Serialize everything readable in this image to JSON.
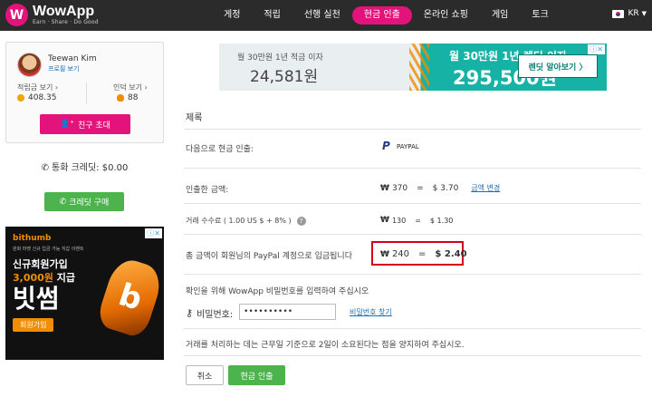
{
  "app": {
    "name": "WowApp",
    "tagline": "Earn · Share · Do Good",
    "logo_letter": "W",
    "brand_color": "#e4137c",
    "accent_green": "#4db34d"
  },
  "nav": {
    "items": [
      {
        "label": "게정"
      },
      {
        "label": "적립"
      },
      {
        "label": "선행 실천"
      },
      {
        "label": "현금 인출"
      },
      {
        "label": "온라인 쇼핑"
      },
      {
        "label": "게임"
      },
      {
        "label": "토크"
      }
    ],
    "active_index": 3,
    "language": "KR"
  },
  "profile": {
    "name": "Teewan Kim",
    "profile_link": "프로필 보기",
    "earnings_label": "적립금 보기",
    "earnings_value": "408.35",
    "karma_label": "인덕 보기",
    "karma_value": "88",
    "invite_button": "친구 초대"
  },
  "call_credit": {
    "label": "통화 크레딧:",
    "value": "$0.00",
    "buy_button": "크레딧 구매"
  },
  "ad_left": {
    "mark": "ⓘ✕",
    "brand": "bithumb",
    "sub": "원화 마켓 신규 입금 가능 지갑 이벤트",
    "line1": "신규회원가입",
    "line2_highlight": "3,000원",
    "line2_rest": " 지급",
    "big": "빗썸",
    "button": "회원가입",
    "coin_letter": "b"
  },
  "ad_top": {
    "mark": "ⓘ✕",
    "left_line1": "월 30만원 1년 적금 이자",
    "left_amount": "24,581원",
    "right_line1": "월 30만원 1년 렌딧 이자",
    "right_amount": "295,500원",
    "button": "렌딧 알아보기 〉"
  },
  "form": {
    "title": "제록",
    "withdraw_via_label": "다음으로 현금 인출:",
    "paypal_label": "PAYPAL",
    "amount_label": "인출한 금액:",
    "amount_won": "370",
    "amount_usd": "$ 3.70",
    "change_amount_link": "금액 변경",
    "fee_label": "거래 수수료 ( 1.00 US $ + 8% )",
    "fee_won": "130",
    "fee_usd": "$ 1.30",
    "total_label": "총 금액이 회원님의 PayPal 계정으로 입금됩니다",
    "total_won": "240",
    "total_usd": "$ 2.40",
    "confirm_prompt": "확인을 위해 WowApp 비밀번호를 입력하여 주십시오",
    "password_label": "비밀번호:",
    "password_value": "••••••••••",
    "forgot_link": "비밀번호 찾기",
    "processing_note": "거래를 처리하는 데는 근무일 기준으로 2일이 소요된다는 점을 양지하여 주십시오.",
    "cancel_button": "취소",
    "submit_button": "현금 인출",
    "won_symbol": "₩",
    "equals": "="
  }
}
